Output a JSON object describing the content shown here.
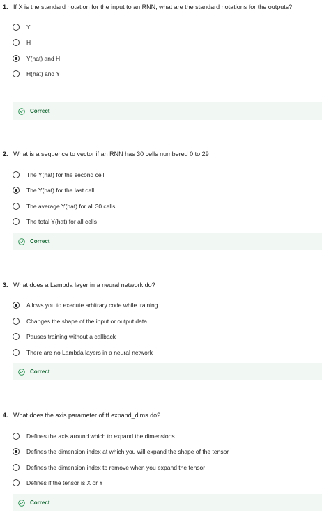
{
  "feedback_text": "Correct",
  "colors": {
    "feedback_bg": "#f1f8f3",
    "feedback_text": "#1e6b3a",
    "check_icon": "#1e8a48"
  },
  "questions": [
    {
      "number": "1.",
      "text": "If X is the standard notation for the input to an RNN, what are the standard notations for the outputs?",
      "selected": 2,
      "options": [
        "Y",
        "H",
        "Y(hat) and H",
        "H(hat) and Y"
      ]
    },
    {
      "number": "2.",
      "text": "What is a sequence to vector if an RNN has 30 cells numbered 0 to 29",
      "selected": 1,
      "options": [
        "The Y(hat) for the second cell",
        "The Y(hat) for the last cell",
        "The average Y(hat) for all 30 cells",
        "The total Y(hat) for all cells"
      ]
    },
    {
      "number": "3.",
      "text": "What does a Lambda layer in a neural network do?",
      "selected": 0,
      "options": [
        "Allows you to execute arbitrary code while training",
        "Changes the shape of the input or output data",
        "Pauses training without a callback",
        "There are no Lambda layers in a neural network"
      ]
    },
    {
      "number": "4.",
      "text": "What does the axis parameter of tf.expand_dims do?",
      "selected": 1,
      "options": [
        "Defines the axis around which to expand the dimensions",
        "Defines the dimension index at which you will expand the shape of the tensor",
        "Defines the dimension index to remove when you expand the tensor",
        "Defines if the tensor is X or Y"
      ]
    }
  ]
}
